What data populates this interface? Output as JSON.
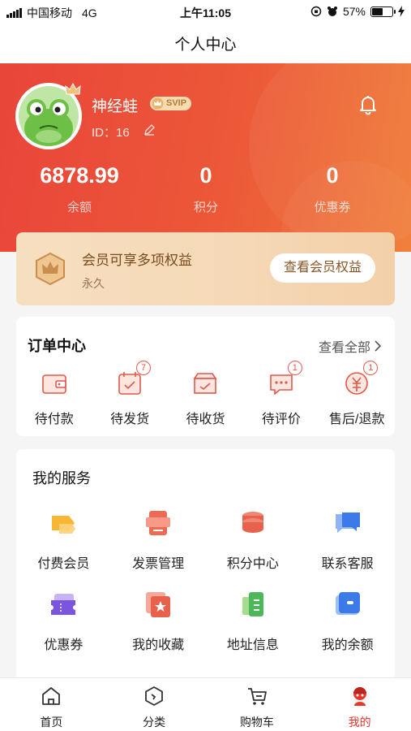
{
  "status_bar": {
    "carrier": "中国移动",
    "network": "4G",
    "time": "上午11:05",
    "battery": "57%",
    "battery_level": 0.57
  },
  "nav": {
    "title": "个人中心"
  },
  "profile": {
    "name": "神经蛙",
    "badge": "SVIP",
    "id_text": "ID：16"
  },
  "stats": [
    {
      "value": "6878.99",
      "label": "余额"
    },
    {
      "value": "0",
      "label": "积分"
    },
    {
      "value": "0",
      "label": "优惠券"
    }
  ],
  "membership": {
    "title": "会员可享多项权益",
    "subtitle": "永久",
    "button": "查看会员权益"
  },
  "orders": {
    "title": "订单中心",
    "view_all": "查看全部",
    "items": [
      {
        "label": "待付款",
        "badge": "",
        "icon": "wallet-icon"
      },
      {
        "label": "待发货",
        "badge": "7",
        "icon": "calendar-check-icon"
      },
      {
        "label": "待收货",
        "badge": "",
        "icon": "box-icon"
      },
      {
        "label": "待评价",
        "badge": "1",
        "icon": "comment-icon"
      },
      {
        "label": "售后/退款",
        "badge": "1",
        "icon": "refund-icon"
      }
    ]
  },
  "services": {
    "title": "我的服务",
    "items": [
      {
        "label": "付费会员",
        "icon": "vip-tag-icon"
      },
      {
        "label": "发票管理",
        "icon": "invoice-icon"
      },
      {
        "label": "积分中心",
        "icon": "coins-icon"
      },
      {
        "label": "联系客服",
        "icon": "chat-icon"
      },
      {
        "label": "优惠券",
        "icon": "ticket-icon"
      },
      {
        "label": "我的收藏",
        "icon": "favorite-icon"
      },
      {
        "label": "地址信息",
        "icon": "address-icon"
      },
      {
        "label": "我的余额",
        "icon": "balance-icon"
      }
    ]
  },
  "tabbar": {
    "items": [
      {
        "label": "首页",
        "icon": "home-icon"
      },
      {
        "label": "分类",
        "icon": "category-icon"
      },
      {
        "label": "购物车",
        "icon": "cart-icon"
      },
      {
        "label": "我的",
        "icon": "me-icon"
      }
    ]
  },
  "colors": {
    "accent": "#e7372d",
    "gold": "#f6dfc0"
  }
}
